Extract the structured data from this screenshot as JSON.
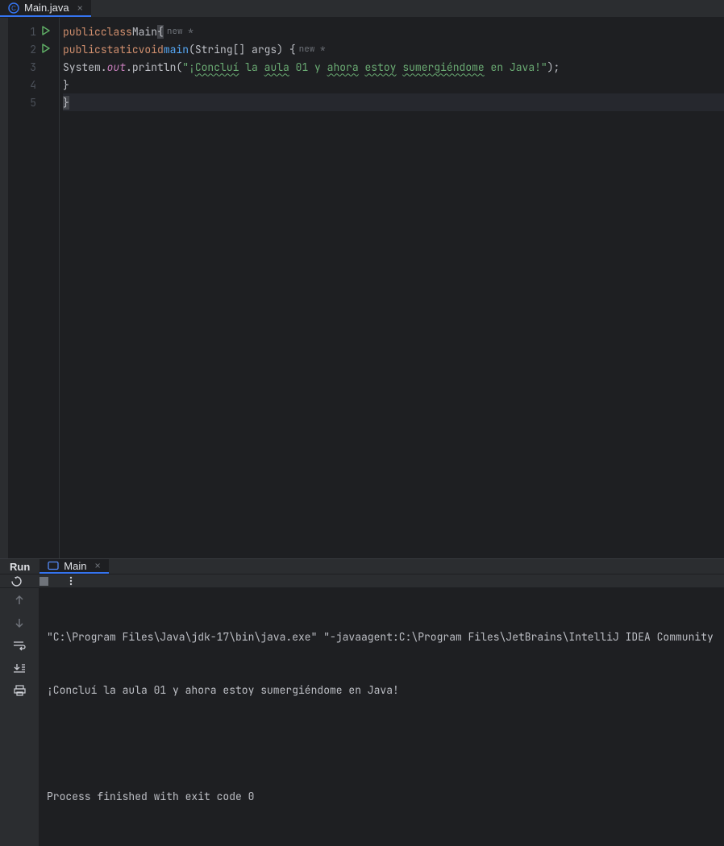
{
  "tab": {
    "filename": "Main.java"
  },
  "code": {
    "lines": [
      "1",
      "2",
      "3",
      "4",
      "5"
    ],
    "line1": {
      "kw_public": "public",
      "kw_class": "class",
      "classname": "Main",
      "brace": "{",
      "hint_new": "new *"
    },
    "line2": {
      "kw_public": "public",
      "kw_static": "static",
      "kw_void": "void",
      "method": "main",
      "params": "(String[] args) {",
      "hint_new": "new *"
    },
    "line3": {
      "system": "System.",
      "out": "out",
      "println": ".println(",
      "str_open": "\"¡",
      "w1": "Concluí",
      "sp1": " la ",
      "w2": "aula",
      "sp2": " 01 y ",
      "w3": "ahora",
      "sp3": " ",
      "w4": "estoy",
      "sp4": " ",
      "w5": "sumergiéndome",
      "sp5": " en Java!\"",
      "close": ");"
    },
    "line4": {
      "brace": "}"
    },
    "line5": {
      "brace": "}"
    }
  },
  "run": {
    "label": "Run",
    "tab_name": "Main",
    "console": {
      "cmd": "\"C:\\Program Files\\Java\\jdk-17\\bin\\java.exe\" \"-javaagent:C:\\Program Files\\JetBrains\\IntelliJ IDEA Community",
      "output": "¡Concluí la aula 01 y ahora estoy sumergiéndome en Java!",
      "exit": "Process finished with exit code 0"
    }
  }
}
